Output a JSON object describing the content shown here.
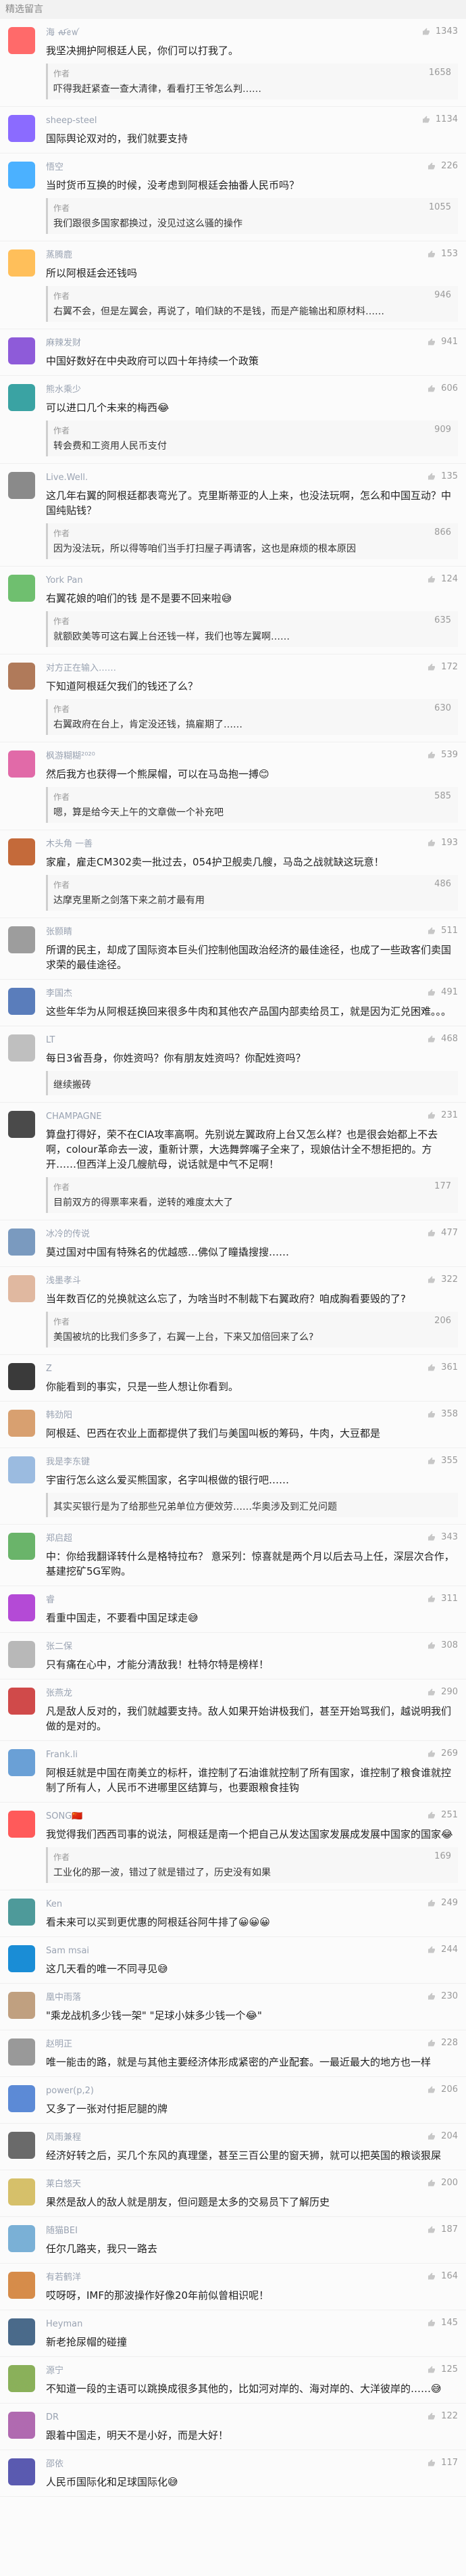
{
  "header": "精选留言",
  "comments": [
    {
      "name": "海 ꫛꫀꪝ",
      "text": "我坚决拥护阿根廷人民，你们可以打我了。",
      "likes": "1343",
      "avatar_color": "#ff6a6a",
      "reply": {
        "author": "作者",
        "text": "吓得我赶紧查一查大清律，看看打王爷怎么判……",
        "likes": "1658"
      }
    },
    {
      "name": "sheep-steel",
      "text": "国际舆论双对的，我们就要支持",
      "likes": "1134",
      "avatar_color": "#8b6bff"
    },
    {
      "name": "悟空",
      "text": "当时货币互换的时候，没考虑到阿根廷会抽番人民币吗？",
      "likes": "226",
      "avatar_color": "#4bb1ff",
      "reply": {
        "author": "作者",
        "text": "我们跟很多国家都换过，没见过这么骚的操作",
        "likes": "1055"
      }
    },
    {
      "name": "蒸腾鹿",
      "text": "所以阿根廷会还钱吗",
      "likes": "153",
      "avatar_color": "#ffbf5a",
      "reply": {
        "author": "作者",
        "text": "右翼不会，但是左翼会，再说了，咱们缺的不是钱，而是产能输出和原材料……",
        "likes": "946"
      }
    },
    {
      "name": "麻辣发财",
      "text": "中国好数好在中央政府可以四十年持续一个政策",
      "likes": "941",
      "avatar_color": "#8e5bd9"
    },
    {
      "name": "熊水乘少",
      "text": "可以进口几个未来的梅西😂",
      "likes": "606",
      "avatar_color": "#3aa3a3",
      "reply": {
        "author": "作者",
        "text": "转会费和工资用人民币支付",
        "likes": "909"
      }
    },
    {
      "name": "Live.Well.",
      "text": "这几年右翼的阿根廷都表弯光了。克里斯蒂亚的人上来，也没法玩啊，怎么和中国互动？中国纯贴钱？",
      "likes": "135",
      "avatar_color": "#8a8a8a",
      "reply": {
        "author": "作者",
        "text": "因为没法玩，所以得等咱们当手打扫屋子再请客，这也是麻烦的根本原因",
        "likes": "866"
      }
    },
    {
      "name": "York Pan",
      "text": "右翼花娘的咱们的钱 是不是要不回来啦😅",
      "likes": "124",
      "avatar_color": "#6fbf6f",
      "reply": {
        "author": "作者",
        "text": "就额欧美等可这右翼上台还钱一样，我们也等左翼啊……",
        "likes": "635"
      }
    },
    {
      "name": "对方正在输入……",
      "text": "下知道阿根廷欠我们的钱还了么？",
      "likes": "172",
      "avatar_color": "#b07a5a",
      "reply": {
        "author": "作者",
        "text": "右翼政府在台上，肯定没还钱，搞雇期了……",
        "likes": "630"
      }
    },
    {
      "name": "枫游糊糊²⁰²⁰",
      "text": "然后我方也获得一个熊屎帽，可以在马岛抱一搏😊",
      "likes": "539",
      "avatar_color": "#e16aa8",
      "reply": {
        "author": "作者",
        "text": "嗯，算是给今天上午的文章做一个补充吧",
        "likes": "585"
      }
    },
    {
      "name": "木头角 一善",
      "text": "家雇，雇走CM302卖一批过去，054护卫舰卖几艘，马岛之战就缺这玩意！",
      "likes": "193",
      "avatar_color": "#c46a3a",
      "reply": {
        "author": "作者",
        "text": "达摩克里斯之剑落下来之前才最有用",
        "likes": "486"
      }
    },
    {
      "name": "张颢睛",
      "text": "所谓的民主，却成了国际资本巨头们控制他国政治经济的最佳途径，也成了一些政客们卖国求荣的最佳途径。",
      "likes": "511",
      "avatar_color": "#9d9d9d"
    },
    {
      "name": "李国杰",
      "text": "这些年华为从阿根廷换回来很多牛肉和其他农产品国内部卖给员工，就是因为汇兑困难。。。",
      "likes": "491",
      "avatar_color": "#5a7dbb"
    },
    {
      "name": "LT",
      "text": "每日3省吾身，你姓资吗？你有朋友姓资吗？你配姓资吗？",
      "likes": "468",
      "avatar_color": "#bfbfbf",
      "reply": {
        "author": "",
        "text": "继续搬砖",
        "likes": ""
      }
    },
    {
      "name": "CHAMPAGNE",
      "text": "算盘打得好，荣不在CIA攻率高啊。先别说左翼政府上台又怎么样？也是很会始都上不去啊，colour革命去一波，重新计票，大选舞弊嘴子全来了，现娘估计全不想拒把的。方开……但西洋上没几艘航母，说话就是中气不足啊！",
      "likes": "231",
      "avatar_color": "#4a4a4a",
      "reply": {
        "author": "作者",
        "text": "目前双方的得票率来看，逆转的难度太大了",
        "likes": "177"
      }
    },
    {
      "name": "冰冷的传说",
      "text": "莫过国对中国有特殊名的优越感…佛似了瞳撬搜搜……",
      "likes": "477",
      "avatar_color": "#7a9abf"
    },
    {
      "name": "浅墨孝斗",
      "text": "当年数百亿的兑换就这么忘了，为啥当时不制裁下右翼政府？咱成胸看要毁的了?",
      "likes": "322",
      "avatar_color": "#e0b8a0",
      "reply": {
        "author": "作者",
        "text": "美国被坑的比我们多多了，右翼一上台，下来又加倍回来了么?",
        "likes": "206"
      }
    },
    {
      "name": "Z",
      "text": "你能看到的事实，只是一些人想让你看到。",
      "likes": "361",
      "avatar_color": "#3a3a3a"
    },
    {
      "name": "韩劲阳",
      "text": "阿根廷、巴西在农业上面都提供了我们与美国叫板的筹码，牛肉，大豆都是",
      "likes": "358",
      "avatar_color": "#d8a070"
    },
    {
      "name": "我是李东键",
      "text": "宇宙行怎么这么爱买熊国家，名字叫根做的银行吧……",
      "likes": "355",
      "avatar_color": "#9bbbe0",
      "reply": {
        "author": "",
        "text": "其实买银行是为了给那些兄弟单位方便效劳……华奥涉及到汇兑问题",
        "likes": ""
      }
    },
    {
      "name": "郑启超",
      "text": "中：你给我翻译转什么是格特拉布？\n意采列：惊喜就是两个月以后去马上任，深层次合作，基建挖矿5G军购。",
      "likes": "343",
      "avatar_color": "#6ab46a"
    },
    {
      "name": "睿",
      "text": "看重中国走，不要看中国足球走😅",
      "likes": "311",
      "avatar_color": "#b44ad6"
    },
    {
      "name": "张二保",
      "text": "只有痛在心中，才能分清敌我！杜特尔特是榜样！",
      "likes": "308",
      "avatar_color": "#b8b8b8"
    },
    {
      "name": "张燕龙",
      "text": "凡是敌人反对的，我们就越要支持。敌人如果开始讲极我们，甚至开始骂我们，越说明我们做的是对的。",
      "likes": "290",
      "avatar_color": "#d04a4a"
    },
    {
      "name": "Frank.li",
      "text": "阿根廷就是中国在南美立的标杆，谁控制了石油谁就控制了所有国家，谁控制了粮食谁就控制了所有人，人民币不进哪里区结算与，也要跟粮食挂钩",
      "likes": "269",
      "avatar_color": "#6aa0d6"
    },
    {
      "name": "SONG🇨🇳",
      "text": "我觉得我们西西司事的说法，阿根廷是南一个把自己从发达国家发展成发展中国家的国家😂",
      "likes": "251",
      "avatar_color": "#ff5a5a",
      "reply": {
        "author": "作者",
        "text": "工业化的那一波，错过了就是错过了，历史没有如果",
        "likes": "169"
      }
    },
    {
      "name": "Ken",
      "text": "看未来可以买到更优惠的阿根廷谷阿牛排了😀😀😀",
      "likes": "249",
      "avatar_color": "#4e9a9a"
    },
    {
      "name": "Sam msai",
      "text": "这几天看的唯一不同寻见😅",
      "likes": "244",
      "avatar_color": "#1a8dd6"
    },
    {
      "name": "凰中雨落",
      "text": "\"乘龙战机多少钱一架\"\n\"足球小妹多少钱一个😂\"",
      "likes": "230",
      "avatar_color": "#c0a080"
    },
    {
      "name": "赵明正",
      "text": "唯一能击的路，就是与其他主要经济体形成紧密的产业配套。一最近最大的地方也一样",
      "likes": "228",
      "avatar_color": "#999999"
    },
    {
      "name": "power(p,2)",
      "text": "又多了一张对付拒尼腿的牌",
      "likes": "206",
      "avatar_color": "#5c8ad6"
    },
    {
      "name": "风雨兼程",
      "text": "经济好转之后，买几个东风的真理堡，甚至三百公里的窗天狮，就可以把英国的粮谈狠屎",
      "likes": "204",
      "avatar_color": "#6a6a6a"
    },
    {
      "name": "莱白悠天",
      "text": "果然是敌人的敌人就是朋友，但问题是太多的交易员下了解历史",
      "likes": "200",
      "avatar_color": "#d6c06a"
    },
    {
      "name": "随猫BEI",
      "text": "任尔几路夹，我只一路去",
      "likes": "187",
      "avatar_color": "#7ab0d6"
    },
    {
      "name": "有若鹤洋",
      "text": "哎呀呀，IMF的那波操作好像20年前似曾相识呢！",
      "likes": "164",
      "avatar_color": "#d68c4a"
    },
    {
      "name": "Heyman",
      "text": "新老抢尿帽的碰撞",
      "likes": "145",
      "avatar_color": "#4a6a8a"
    },
    {
      "name": "源宁",
      "text": "不知道一段的主语可以跳换成很多其他的，比如河对岸的、海对岸的、大洋彼岸的……😅",
      "likes": "125",
      "avatar_color": "#8ab05a"
    },
    {
      "name": "DR",
      "text": "跟着中国走，明天不是小好，而是大好！",
      "likes": "122",
      "avatar_color": "#b06ab0"
    },
    {
      "name": "邵依",
      "text": "人民币国际化和足球国际化😅",
      "likes": "117",
      "avatar_color": "#5a5ab0"
    }
  ],
  "thumb_icon": "thumb-up-icon",
  "colors": {
    "bg": "#fbfbfb",
    "name": "#9aa3b2",
    "text": "#222222"
  }
}
